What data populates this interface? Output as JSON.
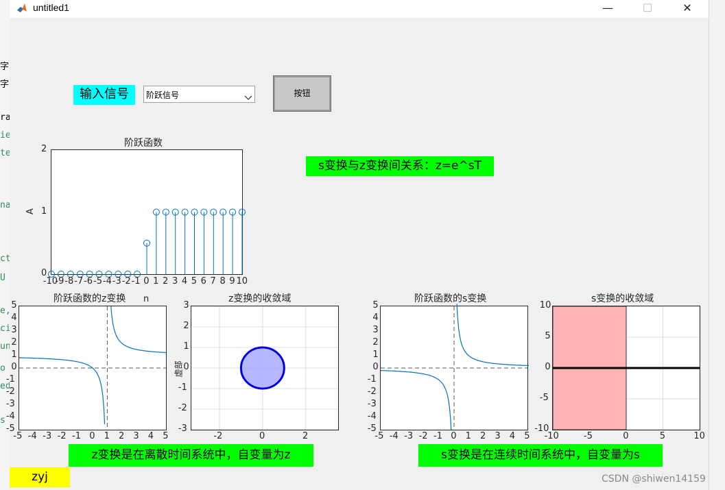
{
  "window": {
    "title": "untitled1",
    "minimize": "—",
    "maximize": "☐",
    "close": "✕"
  },
  "background_editor": {
    "lines": [
      "字",
      "字",
      "ra",
      "ie",
      "te",
      "na",
      "ct",
      "U",
      "e,'",
      "ci",
      "un",
      "o",
      "ed",
      "s"
    ]
  },
  "controls": {
    "input_label": "输入信号",
    "dropdown_value": "阶跃信号",
    "button_label": "按钮"
  },
  "relation_text": "s变换与z变换间关系：z=e^sT",
  "z_note": "z变换是在离散时间系统中，自变量为z",
  "s_note": "s变换是在连续时间系统中，自变量为s",
  "name_tag": "zyj",
  "watermark": "CSDN @shiwen14159",
  "colors": {
    "cyan": "#00ffff",
    "green": "#00ff00",
    "yellow": "#ffff00",
    "series": "#0072bd",
    "roc_fill": "#aaaaff",
    "roc_edge": "#0000e0",
    "s_roc_fill": "#ffb3b3"
  },
  "charts": {
    "step": {
      "title": "阶跃函数",
      "xlabel": "n",
      "ylabel": "A",
      "xticks": [
        "-10",
        "-9",
        "-8",
        "-7",
        "-6",
        "-5",
        "-4",
        "-3",
        "-2",
        "-1",
        "0",
        "1",
        "2",
        "3",
        "4",
        "5",
        "6",
        "7",
        "8",
        "9",
        "10"
      ],
      "yticks": [
        "0",
        "1",
        "2"
      ]
    },
    "zt": {
      "title": "阶跃函数的z变换",
      "xticks": [
        "-5",
        "-4",
        "-3",
        "-2",
        "-1",
        "0",
        "1",
        "2",
        "3",
        "4",
        "5"
      ],
      "yticks": [
        "5",
        "4",
        "3",
        "2",
        "1",
        "0",
        "-1",
        "-2",
        "-3",
        "-4",
        "-5"
      ]
    },
    "zroc": {
      "title": "z变换的收敛域",
      "ylabel": "虚部",
      "xticks": [
        "-2",
        "0",
        "2"
      ],
      "yticks": [
        "3",
        "2",
        "1",
        "0",
        "-1",
        "-2",
        "-3"
      ]
    },
    "st": {
      "title": "阶跃函数的s变换",
      "xticks": [
        "-5",
        "-4",
        "-3",
        "-2",
        "-1",
        "0",
        "1",
        "2",
        "3",
        "4",
        "5"
      ],
      "yticks": [
        "5",
        "4",
        "3",
        "2",
        "1",
        "0",
        "-1",
        "-2",
        "-3",
        "-4",
        "-5"
      ]
    },
    "sroc": {
      "title": "s变换的收敛域",
      "xticks": [
        "-10",
        "-5",
        "0",
        "5",
        "10"
      ],
      "yticks": [
        "10",
        "5",
        "0",
        "-5",
        "-10"
      ]
    }
  },
  "chart_data": [
    {
      "type": "scatter",
      "title": "阶跃函数",
      "xlabel": "n",
      "ylabel": "A",
      "x": [
        -10,
        -9,
        -8,
        -7,
        -6,
        -5,
        -4,
        -3,
        -2,
        -1,
        0,
        1,
        2,
        3,
        4,
        5,
        6,
        7,
        8,
        9,
        10
      ],
      "y": [
        0,
        0,
        0,
        0,
        0,
        0,
        0,
        0,
        0,
        0,
        0.5,
        1,
        1,
        1,
        1,
        1,
        1,
        1,
        1,
        1,
        1
      ],
      "xlim": [
        -10,
        10
      ],
      "ylim": [
        0,
        2
      ],
      "style": "stem"
    },
    {
      "type": "line",
      "title": "阶跃函数的z变换",
      "function": "z/(z-1)",
      "asymptotes": {
        "x": 1,
        "y": 0
      },
      "xlim": [
        -5,
        5
      ],
      "ylim": [
        -5,
        5
      ]
    },
    {
      "type": "area",
      "title": "z变换的收敛域",
      "ylabel": "虚部",
      "circle": {
        "center": [
          0,
          0
        ],
        "radius": 1
      },
      "xlim": [
        -3.3,
        3.5
      ],
      "ylim": [
        -3,
        3
      ],
      "grid": true
    },
    {
      "type": "line",
      "title": "阶跃函数的s变换",
      "function": "1/s",
      "asymptotes": {
        "x": 0,
        "y": 0
      },
      "xlim": [
        -5,
        5
      ],
      "ylim": [
        -5,
        5
      ]
    },
    {
      "type": "area",
      "title": "s变换的收敛域",
      "region": {
        "xmin": -10,
        "xmax": 0
      },
      "xlim": [
        -10,
        10
      ],
      "ylim": [
        -10,
        10
      ],
      "grid": true
    }
  ]
}
